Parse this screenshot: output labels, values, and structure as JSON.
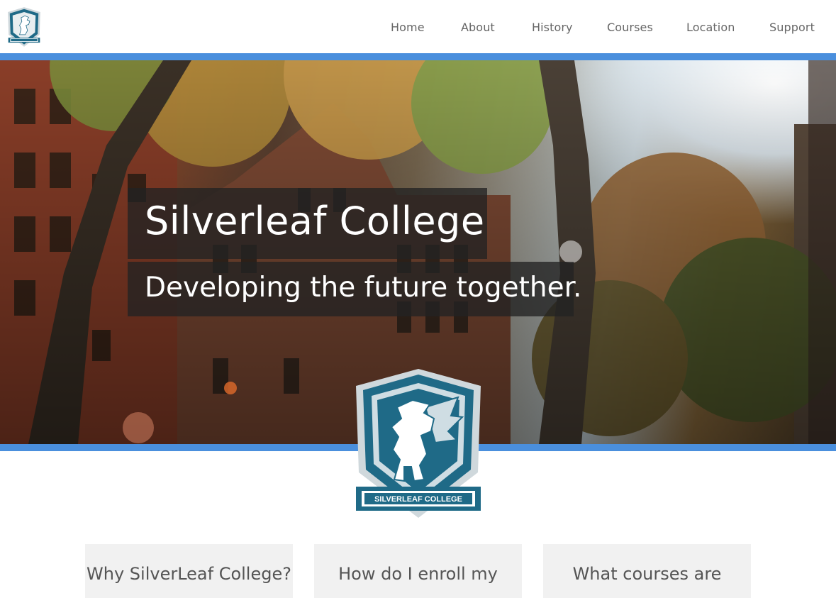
{
  "nav": {
    "items": [
      {
        "label": "Home"
      },
      {
        "label": "About"
      },
      {
        "label": "History"
      },
      {
        "label": "Courses"
      },
      {
        "label": "Location"
      },
      {
        "label": "Support"
      }
    ]
  },
  "hero": {
    "title": "Silverleaf College",
    "subtitle": "Developing the future together."
  },
  "crest": {
    "banner_text": "SILVERLEAF COLLEGE",
    "icon": "pegasus-crest-icon"
  },
  "cards": [
    {
      "title": "Why SilverLeaf College?"
    },
    {
      "title": "How do I enroll my"
    },
    {
      "title": "What courses are"
    }
  ],
  "colors": {
    "accent": "#4a8fdd",
    "crest_teal": "#1f6a87",
    "card_bg": "#f1f1f1"
  }
}
